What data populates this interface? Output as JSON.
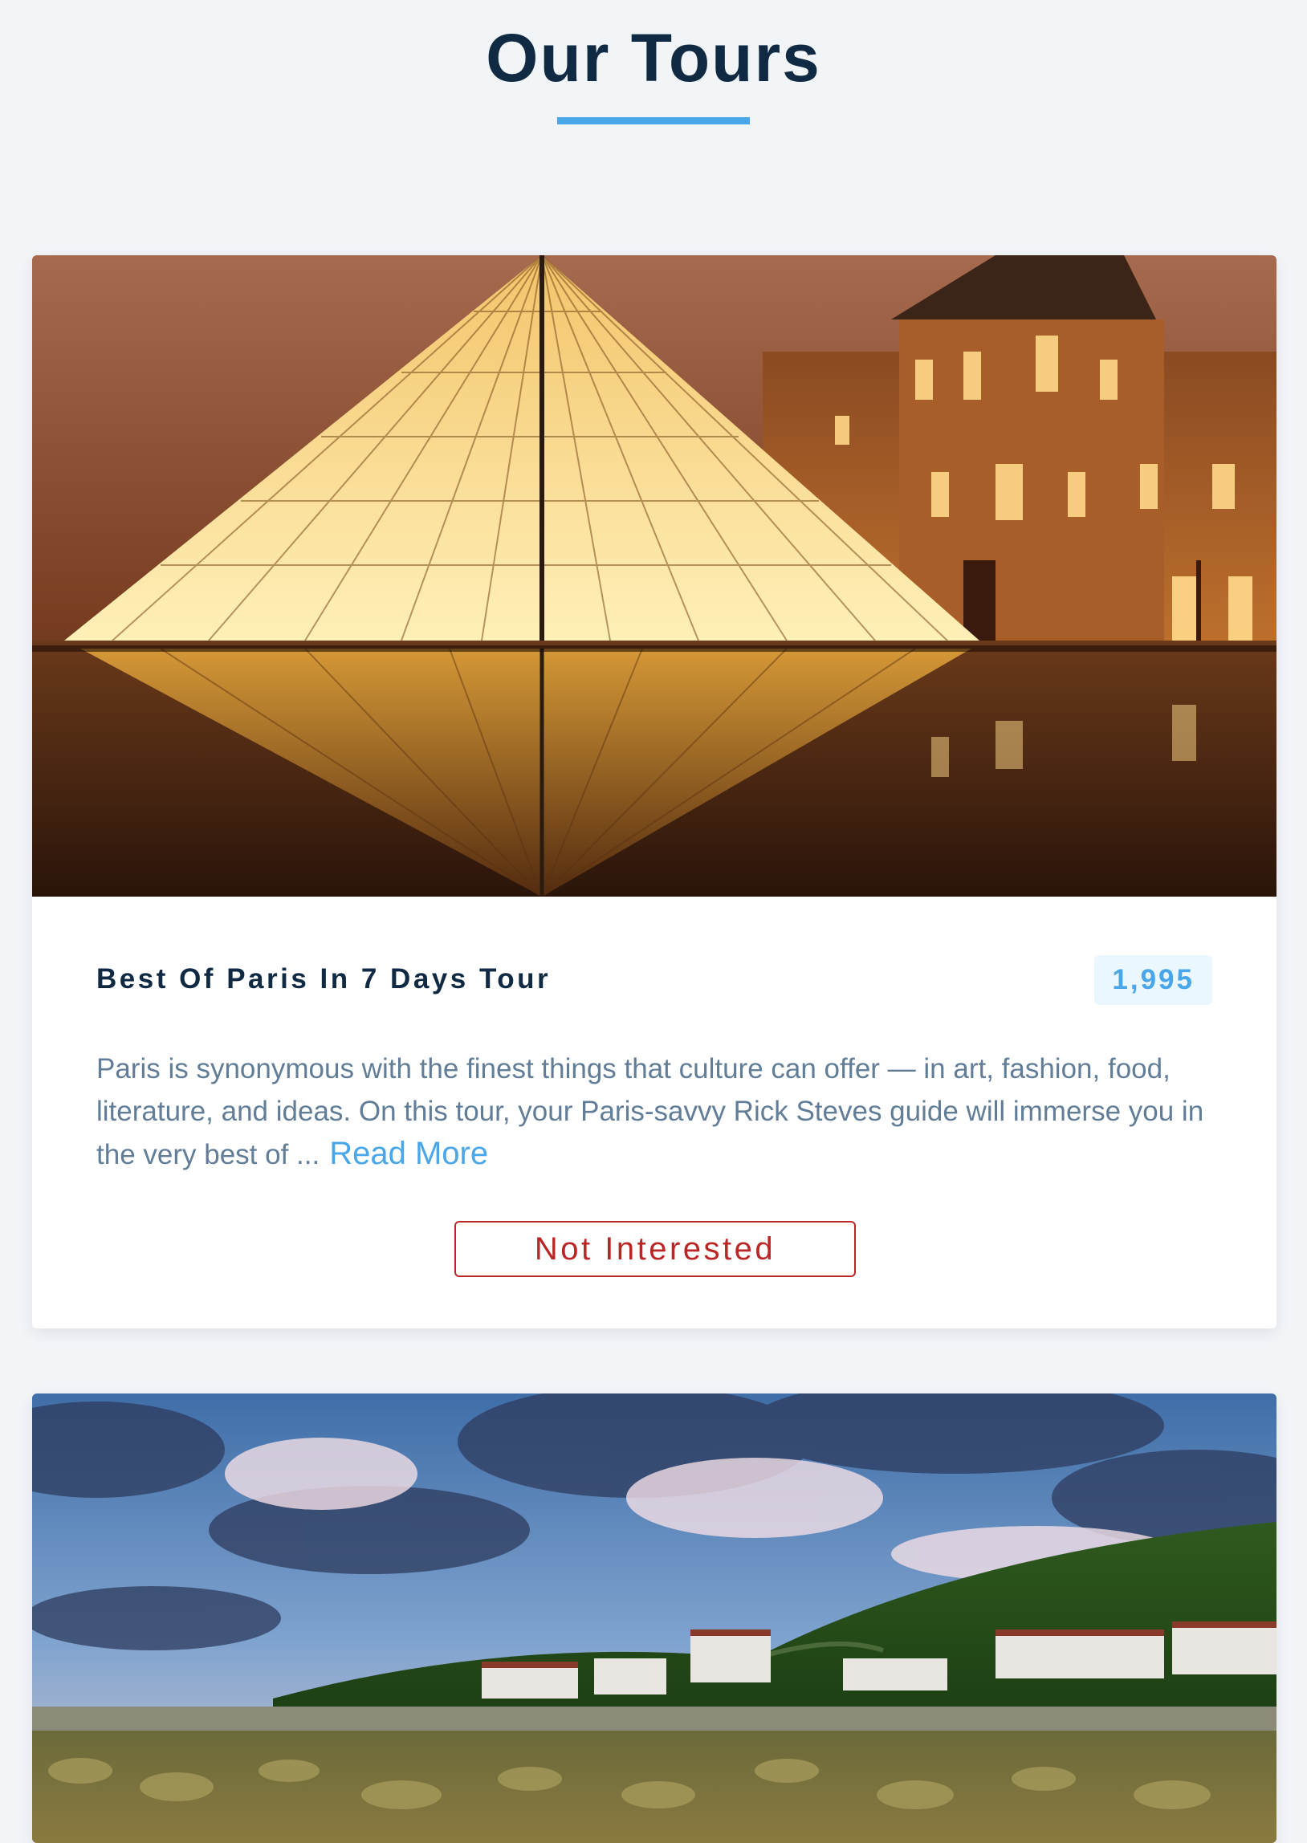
{
  "header": {
    "title": "Our Tours"
  },
  "tours": [
    {
      "name": "Best Of Paris In 7 Days Tour",
      "price": "1,995",
      "description": "Paris is synonymous with the finest things that culture can offer — in art, fashion, food, literature, and ideas. On this tour, your Paris-savvy Rick Steves guide will immerse you in the very best of ...",
      "read_more_label": "Read More",
      "not_interested_label": "Not Interested"
    }
  ],
  "colors": {
    "background": "#f1f5f8",
    "title": "#102a43",
    "accent": "#49a6e9",
    "price_bg": "#ebf7ff",
    "description": "#617d98",
    "danger": "#bb2525"
  }
}
